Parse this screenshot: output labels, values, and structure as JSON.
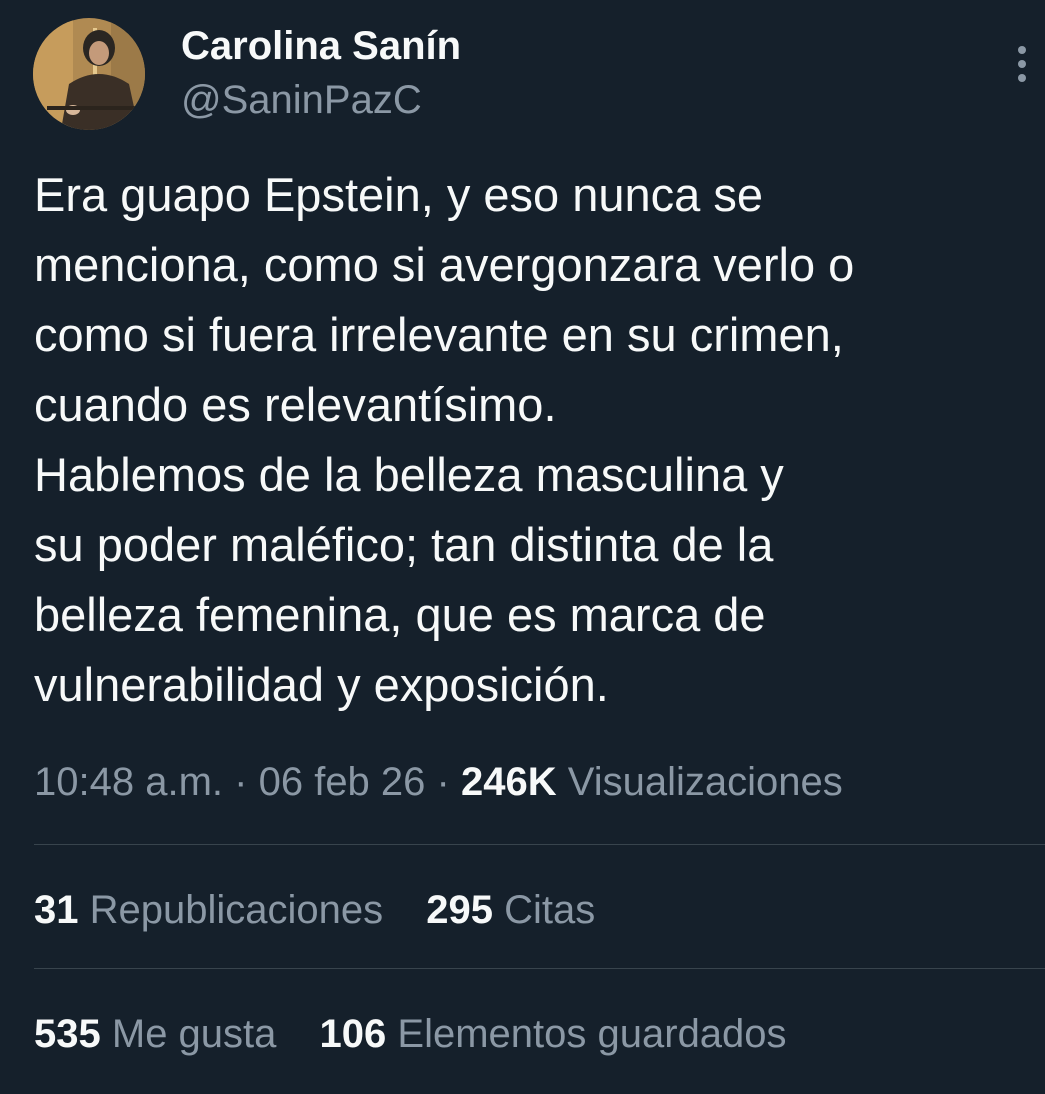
{
  "author": {
    "display_name": "Carolina Sanín",
    "handle": "@SaninPazC"
  },
  "tweet": {
    "lines": [
      "Era guapo Epstein, y eso nunca se",
      "menciona, como si avergonzara verlo o",
      "como si fuera irrelevante en su crimen,",
      "cuando es relevantísimo.",
      "Hablemos de la belleza masculina y",
      "su poder maléfico; tan distinta de la",
      "belleza femenina, que es marca de",
      "vulnerabilidad y exposición."
    ],
    "time": "10:48 a.m.",
    "separator": "·",
    "date": "06 feb 26",
    "views_count": "246K",
    "views_label": "Visualizaciones"
  },
  "stats": {
    "reposts": {
      "count": "31",
      "label": "Republicaciones"
    },
    "quotes": {
      "count": "295",
      "label": "Citas"
    },
    "likes": {
      "count": "535",
      "label": "Me gusta"
    },
    "bookmarks": {
      "count": "106",
      "label": "Elementos guardados"
    }
  },
  "colors": {
    "background": "#15202b",
    "text": "#f7f9f9",
    "secondary": "#8b98a5",
    "divider": "#38444d"
  },
  "icons": {
    "more": "more-vertical-icon"
  }
}
